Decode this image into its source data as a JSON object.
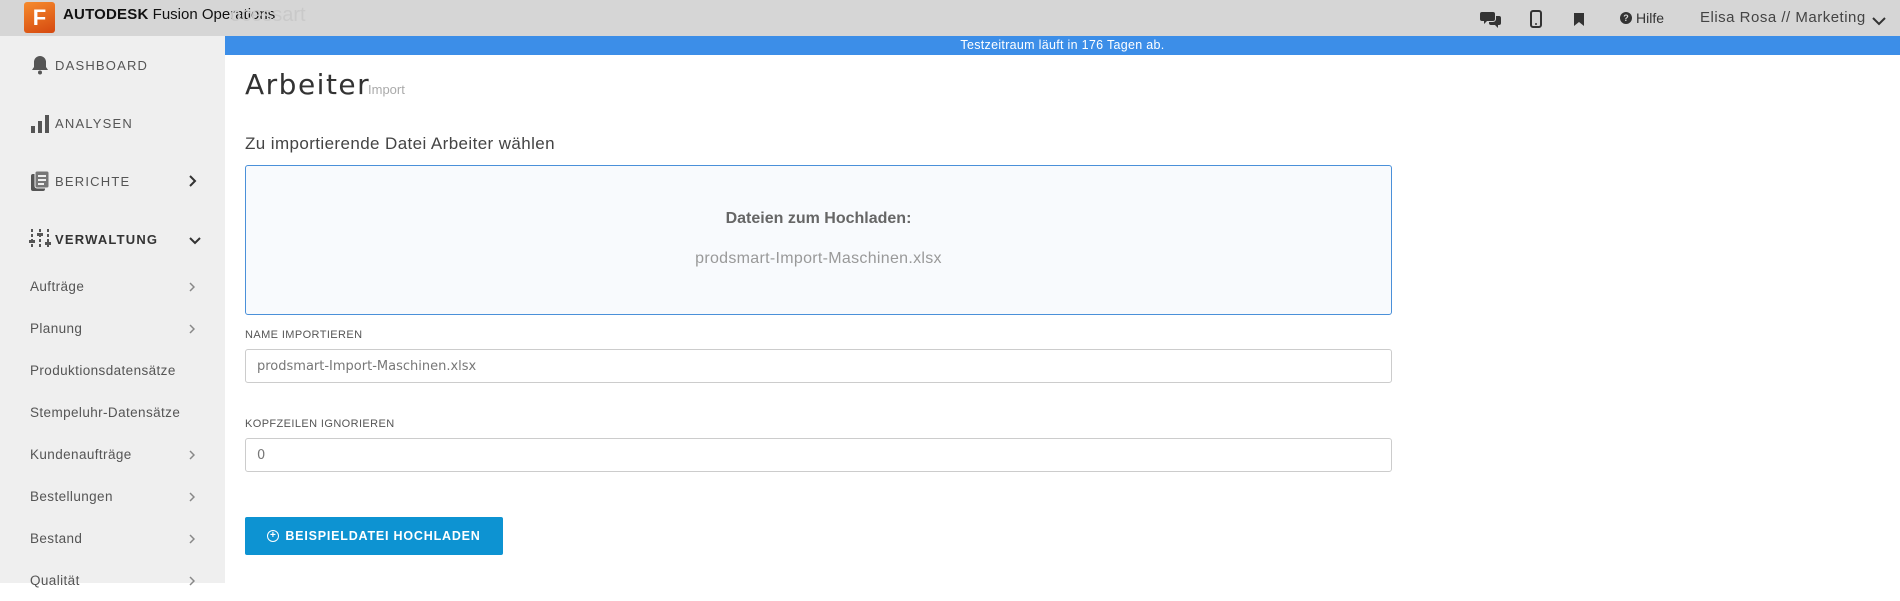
{
  "app": {
    "logo_letter": "F",
    "brand_bold": "AUTODESK",
    "brand_product": "Fusion Operations",
    "brand_ghost": "ocessart"
  },
  "header": {
    "help_label": "Hilfe",
    "user_label": "Elisa Rosa // Marketing",
    "icons": [
      "chat-icon",
      "mobile-icon",
      "bookmark-icon",
      "help-icon",
      "chevron-down-icon"
    ]
  },
  "trial_banner": "Testzeitraum läuft in 176 Tagen ab.",
  "sidebar": {
    "main": [
      {
        "label": "DASHBOARD",
        "icon": "bell-icon"
      },
      {
        "label": "ANALYSEN",
        "icon": "bar-chart-icon"
      },
      {
        "label": "BERICHTE",
        "icon": "report-icon"
      },
      {
        "label": "VERWALTUNG",
        "icon": "sliders-icon"
      }
    ],
    "sub": [
      {
        "label": "Aufträge"
      },
      {
        "label": "Planung"
      },
      {
        "label": "Produktionsdatensätze"
      },
      {
        "label": "Stempeluhr-Datensätze"
      },
      {
        "label": "Kundenaufträge"
      },
      {
        "label": "Bestellungen"
      },
      {
        "label": "Bestand"
      },
      {
        "label": "Qualität"
      }
    ]
  },
  "page": {
    "title": "Arbeiter",
    "subtitle": "Import",
    "section_heading": "Zu importierende Datei Arbeiter wählen",
    "dropzone_title": "Dateien zum Hochladen:",
    "dropzone_file": "prodsmart-Import-Maschinen.xlsx",
    "name_label": "NAME IMPORTIEREN",
    "name_value": "prodsmart-Import-Maschinen.xlsx",
    "header_rows_label": "KOPFZEILEN IGNORIEREN",
    "header_rows_value": "0",
    "upload_button": "BEISPIELDATEI HOCHLADEN"
  },
  "colors": {
    "accent": "#0d93d2",
    "banner": "#3c8ee8",
    "dropzone_border": "#4a90d9",
    "sidebar_bg": "#efefef",
    "topbar_bg": "#d6d6d6"
  }
}
